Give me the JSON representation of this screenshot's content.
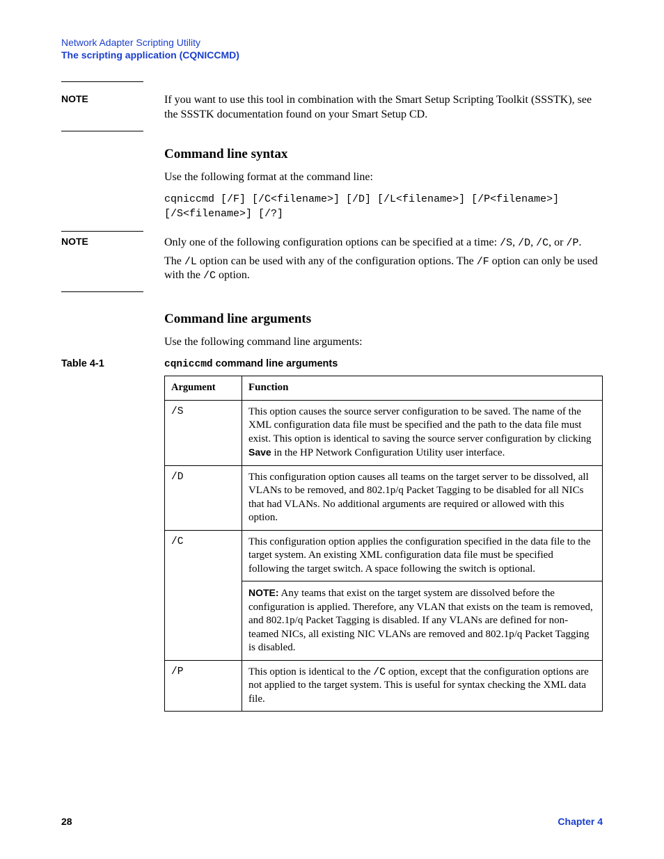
{
  "header": {
    "line1": "Network Adapter Scripting Utility",
    "line2": "The scripting application (CQNICCMD)"
  },
  "note1": {
    "label": "NOTE",
    "body": "If you want to use this tool in combination with the Smart Setup Scripting Toolkit (SSSTK), see the SSSTK documentation found on your Smart Setup CD."
  },
  "section1": {
    "heading": "Command line syntax",
    "lead": "Use the following format at the command line:",
    "code": "cqniccmd [/F] [/C<filename>] [/D] [/L<filename>] [/P<filename>] [/S<filename>] [/?]"
  },
  "note2": {
    "label": "NOTE",
    "p1a": "Only one of the following configuration options can be specified at a time: ",
    "p1_s": "/S",
    "p1_sep1": ", ",
    "p1_d": "/D",
    "p1_sep2": ", ",
    "p1_c": "/C",
    "p1_sep3": ", or ",
    "p1_p": "/P",
    "p1_end": ".",
    "p2a": "The ",
    "p2_l": "/L",
    "p2b": " option can be used with any of the configuration options. The ",
    "p2_f": "/F",
    "p2c": " option can only be used with the ",
    "p2_c2": "/C",
    "p2d": " option."
  },
  "section2": {
    "heading": "Command line arguments",
    "lead": "Use the following command line arguments:"
  },
  "table": {
    "label": "Table 4-1",
    "caption_code": "cqniccmd",
    "caption_rest": " command line arguments",
    "headers": {
      "arg": "Argument",
      "func": "Function"
    },
    "rows": [
      {
        "arg": "/S",
        "func_a": "This option causes the source server configuration to be saved. The name of the XML configuration data file must be specified and the path to the data file must exist. This option is identical to saving the source server configuration by clicking ",
        "func_bold": "Save",
        "func_b": " in the HP Network Configuration Utility user interface."
      },
      {
        "arg": "/D",
        "func": "This configuration option causes all teams on the target server to be dissolved, all VLANs to be removed, and 802.1p/q Packet Tagging to be disabled for all NICs that had VLANs. No additional arguments are required or allowed with this option."
      },
      {
        "arg": "/C",
        "func": "This configuration option applies the configuration specified in the data file to the target system. An existing XML configuration data file must be specified following the target switch. A space following the switch is optional.",
        "note_label": "NOTE:",
        "note_body": "  Any teams that exist on the target system are dissolved before the configuration is applied. Therefore, any VLAN that exists on the team is removed, and 802.1p/q Packet Tagging is disabled. If any VLANs are defined for non-teamed NICs, all existing NIC VLANs are removed and 802.1p/q Packet Tagging is disabled."
      },
      {
        "arg": "/P",
        "func_a": "This option is identical to the ",
        "func_code": "/C",
        "func_b": " option, except that the configuration options are not applied to the target system. This is useful for syntax checking the XML data file."
      }
    ]
  },
  "footer": {
    "page": "28",
    "chapter": "Chapter 4"
  }
}
